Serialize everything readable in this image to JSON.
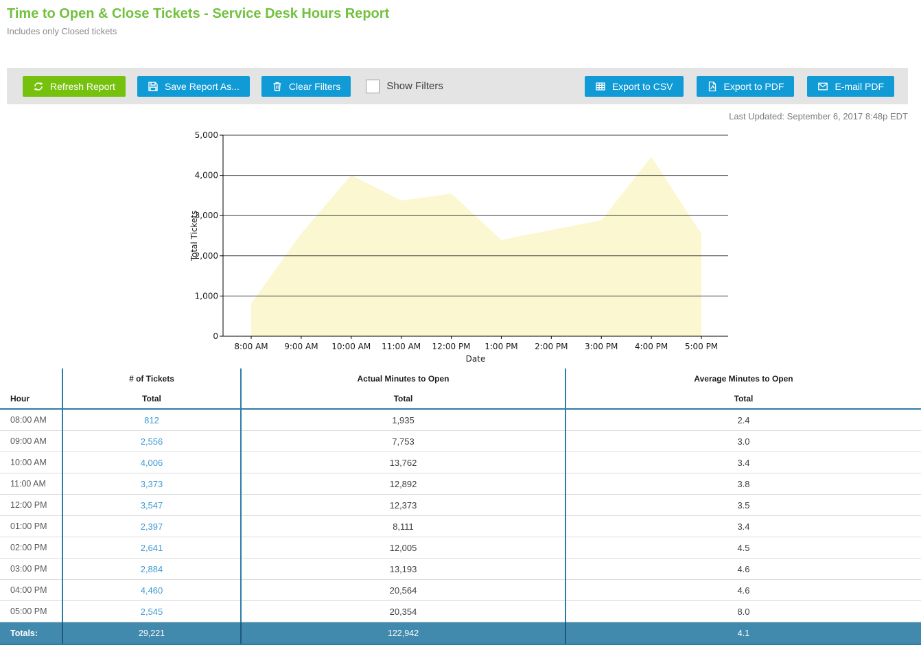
{
  "header": {
    "title": "Time to Open & Close Tickets - Service Desk Hours Report",
    "subtitle": "Includes only Closed tickets"
  },
  "toolbar": {
    "refresh_label": "Refresh Report",
    "save_label": "Save Report As...",
    "clear_label": "Clear Filters",
    "show_filters_label": "Show Filters",
    "export_csv_label": "Export to CSV",
    "export_pdf_label": "Export to PDF",
    "email_pdf_label": "E-mail PDF",
    "show_filters_checked": false
  },
  "last_updated": "Last Updated: September 6, 2017 8:48p EDT",
  "colors": {
    "title_green": "#72c13e",
    "button_green": "#76c10d",
    "button_blue": "#109ad6",
    "toolbar_bg": "#e4e4e4",
    "table_line_blue": "#2d7ca8",
    "totals_bg": "#4289ae",
    "totals_divider": "#1b5a7d",
    "link_blue": "#3e9ad5",
    "area_fill": "#fbf7d1"
  },
  "chart_data": {
    "type": "area",
    "title": "",
    "xlabel": "Date",
    "ylabel": "Total Tickets",
    "categories": [
      "8:00 AM",
      "9:00 AM",
      "10:00 AM",
      "11:00 AM",
      "12:00 PM",
      "1:00 PM",
      "2:00 PM",
      "3:00 PM",
      "4:00 PM",
      "5:00 PM"
    ],
    "values": [
      812,
      2556,
      4006,
      3373,
      3547,
      2397,
      2641,
      2884,
      4460,
      2545
    ],
    "ylim": [
      0,
      5000
    ],
    "yticks": [
      0,
      1000,
      2000,
      3000,
      4000,
      5000
    ],
    "ytick_labels": [
      "0",
      "1,000",
      "2,000",
      "3,000",
      "4,000",
      "5,000"
    ],
    "grid": true,
    "legend": false,
    "fill_color": "#fbf7d1"
  },
  "table": {
    "group_headers": [
      "",
      "# of Tickets",
      "Actual Minutes to Open",
      "Average Minutes to Open"
    ],
    "sub_headers": [
      "Hour",
      "Total",
      "Total",
      "Total"
    ],
    "rows": [
      {
        "hour": "08:00 AM",
        "tickets": "812",
        "actual": "1,935",
        "avg": "2.4"
      },
      {
        "hour": "09:00 AM",
        "tickets": "2,556",
        "actual": "7,753",
        "avg": "3.0"
      },
      {
        "hour": "10:00 AM",
        "tickets": "4,006",
        "actual": "13,762",
        "avg": "3.4"
      },
      {
        "hour": "11:00 AM",
        "tickets": "3,373",
        "actual": "12,892",
        "avg": "3.8"
      },
      {
        "hour": "12:00 PM",
        "tickets": "3,547",
        "actual": "12,373",
        "avg": "3.5"
      },
      {
        "hour": "01:00 PM",
        "tickets": "2,397",
        "actual": "8,111",
        "avg": "3.4"
      },
      {
        "hour": "02:00 PM",
        "tickets": "2,641",
        "actual": "12,005",
        "avg": "4.5"
      },
      {
        "hour": "03:00 PM",
        "tickets": "2,884",
        "actual": "13,193",
        "avg": "4.6"
      },
      {
        "hour": "04:00 PM",
        "tickets": "4,460",
        "actual": "20,564",
        "avg": "4.6"
      },
      {
        "hour": "05:00 PM",
        "tickets": "2,545",
        "actual": "20,354",
        "avg": "8.0"
      }
    ],
    "totals": {
      "label": "Totals:",
      "tickets": "29,221",
      "actual": "122,942",
      "avg": "4.1"
    }
  }
}
